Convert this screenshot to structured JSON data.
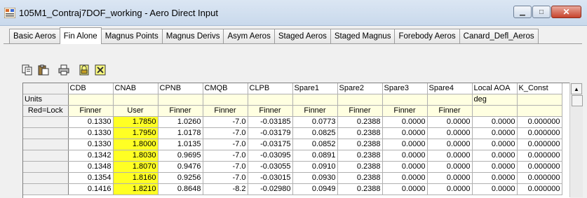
{
  "window": {
    "title": "105M1_Contraj7DOF_working - Aero Direct Input"
  },
  "tabs": [
    {
      "label": "Basic Aeros",
      "active": false
    },
    {
      "label": "Fin Alone",
      "active": true
    },
    {
      "label": "Magnus Points",
      "active": false
    },
    {
      "label": "Magnus Derivs",
      "active": false
    },
    {
      "label": "Asym Aeros",
      "active": false
    },
    {
      "label": "Staged Aeros",
      "active": false
    },
    {
      "label": "Staged Magnus",
      "active": false
    },
    {
      "label": "Forebody Aeros",
      "active": false
    },
    {
      "label": "Canard_Defl_Aeros",
      "active": false
    }
  ],
  "toolbar": {
    "icons": [
      "copy-icon",
      "paste-icon",
      "print-icon",
      "lock-icon",
      "delete-icon"
    ]
  },
  "grid": {
    "columns": [
      "CDB",
      "CNAB",
      "CPNB",
      "CMQB",
      "CLPB",
      "Spare1",
      "Spare2",
      "Spare3",
      "Spare4",
      "Local AOA",
      "K_Const"
    ],
    "units_label": "Units",
    "units": [
      "",
      "",
      "",
      "",
      "",
      "",
      "",
      "",
      "",
      "deg",
      ""
    ],
    "lock_label": "Red=Lock",
    "sources": [
      "Finner",
      "User",
      "Finner",
      "Finner",
      "Finner",
      "Finner",
      "Finner",
      "Finner",
      "Finner",
      "",
      ""
    ],
    "rows": [
      [
        "0.1330",
        "1.7850",
        "1.0260",
        "-7.0",
        "-0.03185",
        "0.0773",
        "0.2388",
        "0.0000",
        "0.0000",
        "0.0000",
        "0.000000"
      ],
      [
        "0.1330",
        "1.7950",
        "1.0178",
        "-7.0",
        "-0.03179",
        "0.0825",
        "0.2388",
        "0.0000",
        "0.0000",
        "0.0000",
        "0.000000"
      ],
      [
        "0.1330",
        "1.8000",
        "1.0135",
        "-7.0",
        "-0.03175",
        "0.0852",
        "0.2388",
        "0.0000",
        "0.0000",
        "0.0000",
        "0.000000"
      ],
      [
        "0.1342",
        "1.8030",
        "0.9695",
        "-7.0",
        "-0.03095",
        "0.0891",
        "0.2388",
        "0.0000",
        "0.0000",
        "0.0000",
        "0.000000"
      ],
      [
        "0.1348",
        "1.8070",
        "0.9476",
        "-7.0",
        "-0.03055",
        "0.0910",
        "0.2388",
        "0.0000",
        "0.0000",
        "0.0000",
        "0.000000"
      ],
      [
        "0.1354",
        "1.8160",
        "0.9256",
        "-7.0",
        "-0.03015",
        "0.0930",
        "0.2388",
        "0.0000",
        "0.0000",
        "0.0000",
        "0.000000"
      ],
      [
        "0.1416",
        "1.8210",
        "0.8648",
        "-8.2",
        "-0.02980",
        "0.0949",
        "0.2388",
        "0.0000",
        "0.0000",
        "0.0000",
        "0.000000"
      ]
    ],
    "highlight_color": "#ffff24"
  },
  "window_buttons": {
    "minimize": "▁",
    "maximize": "□",
    "close": "✕"
  }
}
